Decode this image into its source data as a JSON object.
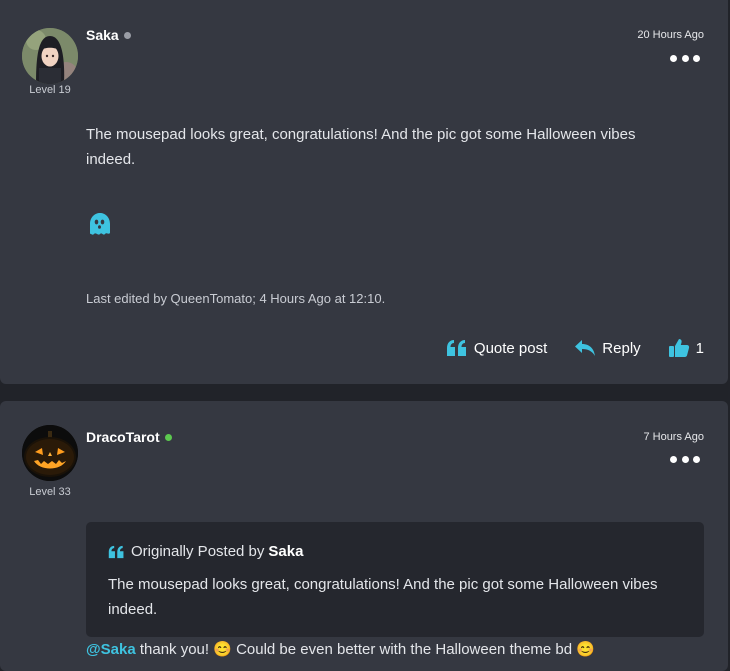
{
  "colors": {
    "accent": "#3ec3e0",
    "card_bg": "#353841",
    "quote_bg": "#25272e",
    "offline_dot": "#9a9da5",
    "online_dot": "#5cc94f"
  },
  "posts": [
    {
      "username": "Saka",
      "status": "offline",
      "level": "Level 19",
      "timestamp": "20 Hours Ago",
      "body": "The mousepad looks great, congratulations! And the pic got some Halloween vibes indeed.",
      "emoji": "ghost-icon",
      "edited": "Last edited by QueenTomato; 4 Hours Ago at 12:10.",
      "actions": {
        "quote_label": "Quote post",
        "reply_label": "Reply",
        "like_count": "1"
      }
    },
    {
      "username": "DracoTarot",
      "status": "online",
      "level": "Level 33",
      "timestamp": "7 Hours Ago",
      "quote": {
        "prefix": "Originally Posted by",
        "author": "Saka",
        "text": "The mousepad looks great, congratulations! And the pic got some Halloween vibes indeed."
      },
      "reply_mention": "@Saka",
      "reply_partial": " thank you! 😊 Could be even better with the Halloween theme bd 😊"
    }
  ]
}
